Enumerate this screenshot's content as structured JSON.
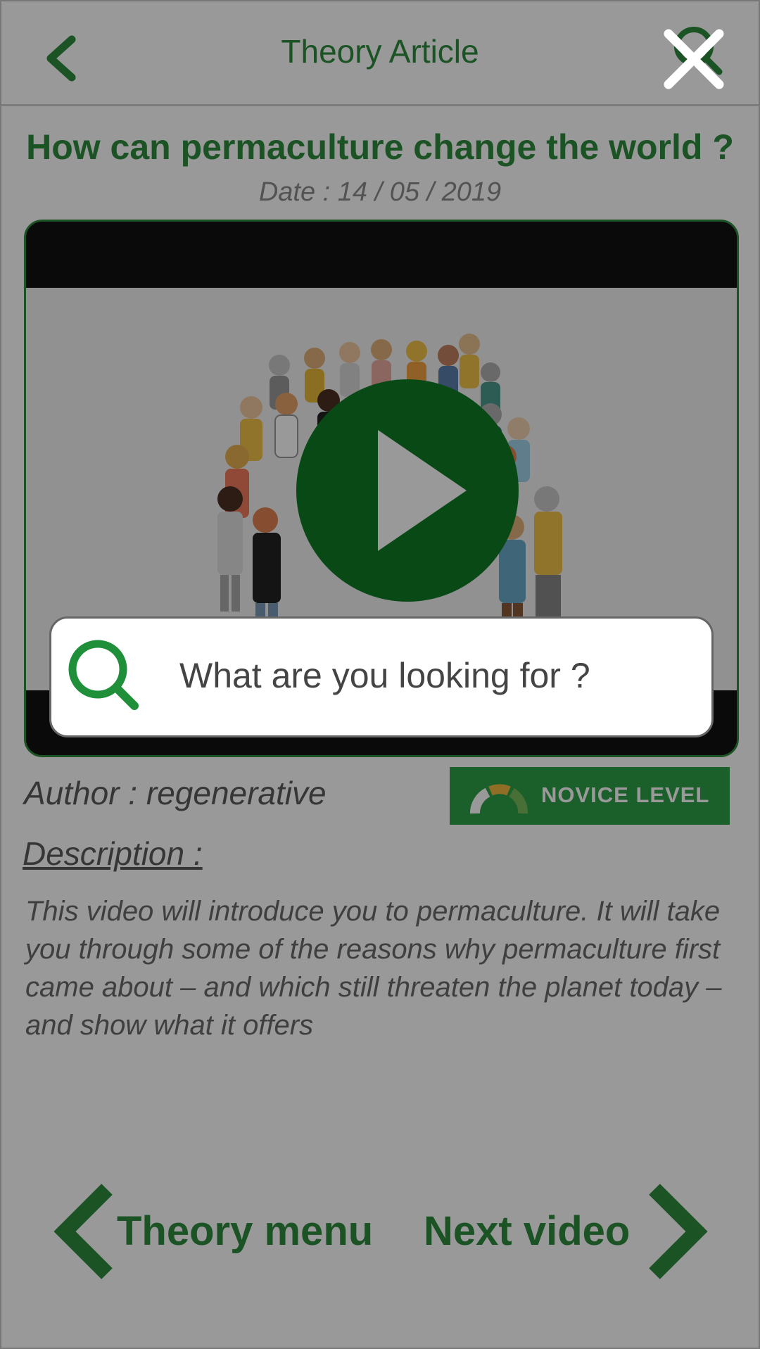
{
  "header": {
    "title": "Theory Article",
    "back_icon": "chevron-left-icon",
    "search_icon": "search-icon"
  },
  "article": {
    "title": "How can permaculture change the world ?",
    "date": "Date : 14 / 05 / 2019",
    "author": "Author : regenerative",
    "level": "NOVICE LEVEL",
    "description_label": "Description :",
    "description": "This video will introduce you to permaculture. It will take you through some of the reasons why permaculture first came about – and which still threaten the planet today – and show what it offers"
  },
  "navigation": {
    "prev_label": "Theory menu",
    "next_label": "Next video"
  },
  "search_overlay": {
    "placeholder": "What are you looking for ?",
    "close_icon": "close-icon"
  },
  "colors": {
    "brand_green": "#2e8b3e",
    "badge_green": "#2e9e48",
    "play_green": "#0e7a26",
    "overlay": "rgba(0,0,0,0.40)"
  }
}
